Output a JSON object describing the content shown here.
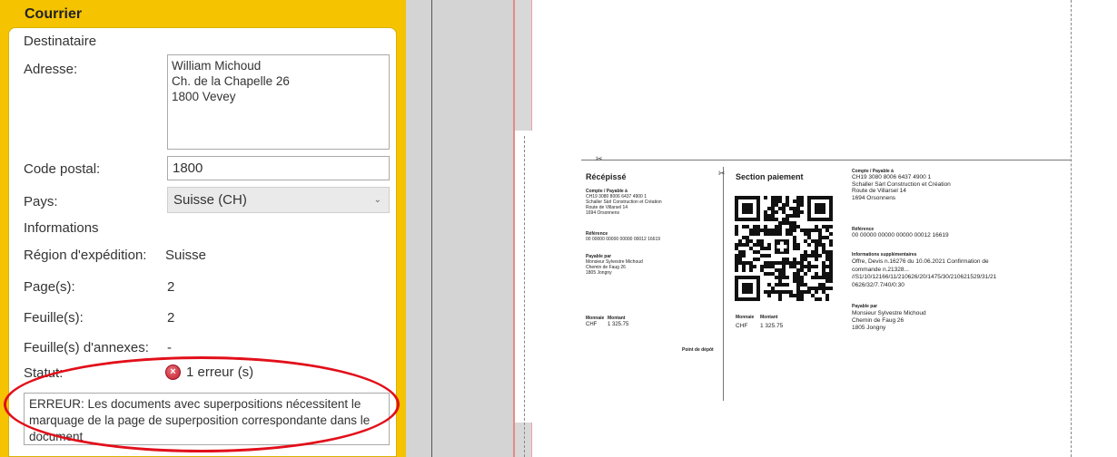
{
  "panel": {
    "title": "Courrier",
    "destinataire_title": "Destinataire",
    "address_label": "Adresse:",
    "address_lines": [
      "William Michoud",
      "Ch. de la Chapelle 26",
      "1800 Vevey"
    ],
    "postal_label": "Code postal:",
    "postal_value": "1800",
    "country_label": "Pays:",
    "country_value": "Suisse (CH)",
    "informations_title": "Informations",
    "region_label": "Région d'expédition:",
    "region_value": "Suisse",
    "pages_label": "Page(s):",
    "pages_value": "2",
    "sheets_label": "Feuille(s):",
    "sheets_value": "2",
    "annex_label": "Feuille(s) d'annexes:",
    "annex_value": "-",
    "status_label": "Statut:",
    "status_value": "1 erreur (s)",
    "error_message": "ERREUR: Les documents avec superpositions nécessitent le marquage de la page de superposition correspondante dans le document"
  },
  "document": {
    "receipt": {
      "title": "Récépissé",
      "account_label": "Compte / Payable à",
      "account_lines": [
        "CH19 3080 8006 6437 4900 1",
        "Schaller Sàrl Construction et Création",
        "Route de Villarsel 14",
        "1694 Orsonnens"
      ],
      "reference_label": "Référence",
      "reference_value": "00 00000 00000 00000 00012 16619",
      "payable_by_label": "Payable par",
      "payable_by_lines": [
        "Monsieur Sylvestre Michoud",
        "Chemin de Faug 26",
        "1805 Jongny"
      ],
      "currency_label": "Monnaie",
      "amount_label": "Montant",
      "currency_value": "CHF",
      "amount_value": "1 325.75",
      "depot_label": "Point de dépôt"
    },
    "payment": {
      "title": "Section paiement",
      "account_label": "Compte / Payable à",
      "account_lines": [
        "CH19 3080 8006 6437 4900 1",
        "Schaller Sàrl Construction et Création",
        "Route de Villarsel 14",
        "1694 Orsonnens"
      ],
      "reference_label": "Référence",
      "reference_value": "00 00000 00000 00000 00012 16619",
      "additional_label": "Informations supplémentaires",
      "additional_lines": [
        "Offre, Devis n.16276 du 10.06.2021 Confirmation de",
        "commande n.21328...",
        "//S1/10/12166/11/210626/20/1475/30/210621529/31/21",
        "0626/32/7.7/40/0:30"
      ],
      "payable_by_label": "Payable par",
      "payable_by_lines": [
        "Monsieur Sylvestre Michoud",
        "Chemin de Faug 26",
        "1805 Jongny"
      ],
      "currency_label": "Monnaie",
      "amount_label": "Montant",
      "currency_value": "CHF",
      "amount_value": "1 325.75"
    }
  },
  "colors": {
    "panel_accent": "#f5c300",
    "error_highlight": "#e20f1a",
    "status_error_icon": "#c21e2d"
  }
}
